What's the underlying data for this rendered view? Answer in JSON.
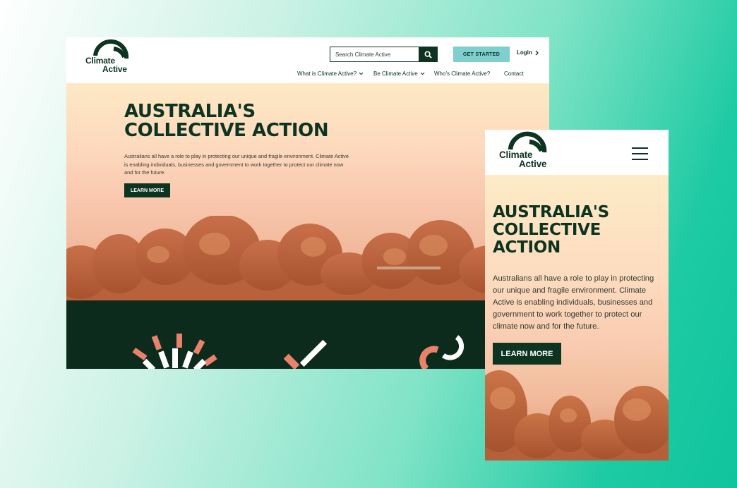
{
  "brand": {
    "logo_line1": "Climate",
    "logo_line2": "Active",
    "primary_color": "#0d3321",
    "accent_color": "#7ecfce",
    "highlight_color": "#e8826d"
  },
  "desktop": {
    "search": {
      "placeholder": "Search Climate Active",
      "icon": "search-icon"
    },
    "get_started_label": "GET STARTED",
    "login_label": "Login",
    "nav": [
      {
        "label": "What is Climate Active?",
        "has_dropdown": true
      },
      {
        "label": "Be Climate Active",
        "has_dropdown": true
      },
      {
        "label": "Who's Climate Active?",
        "has_dropdown": false
      },
      {
        "label": "Contact",
        "has_dropdown": false
      }
    ],
    "hero": {
      "title_line1": "AUSTRALIA'S",
      "title_line2": "COLLECTIVE ACTION",
      "body": "Australians all have a role to play in protecting our unique and fragile environment. Climate Active is enabling individuals, businesses and government to work together to protect our climate now and for the future.",
      "cta_label": "LEARN MORE"
    },
    "feature_icons": [
      "sunburst-icon",
      "checkmark-icon",
      "cycle-icon"
    ]
  },
  "mobile": {
    "menu_icon": "hamburger-icon",
    "hero": {
      "title_line1": "AUSTRALIA'S",
      "title_line2": "COLLECTIVE",
      "title_line3": "ACTION",
      "body": "Australians all have a role to play in protecting our unique and fragile environment. Climate Active is enabling individuals, businesses and government to work together to protect our climate now and for the future.",
      "cta_label": "LEARN MORE"
    }
  }
}
